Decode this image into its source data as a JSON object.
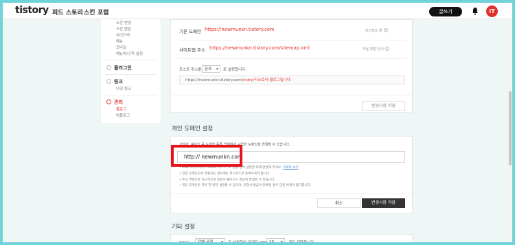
{
  "header": {
    "logo": "tistory",
    "nav": [
      "피드",
      "스토리",
      "스킨",
      "포럼"
    ],
    "write_button": "글쓰기",
    "avatar_text": "IT"
  },
  "sidebar": {
    "sub_items_top": [
      "스킨 변경",
      "스킨 편집",
      "사이드바",
      "메뉴",
      "모바일",
      "메뉴바/구독 설정"
    ],
    "plugin": "플러그인",
    "link": {
      "title": "링크",
      "sub": "나의 링크"
    },
    "manage": {
      "title": "관리",
      "subs": [
        "블로그",
        "팀블로그"
      ]
    }
  },
  "blog_settings": {
    "default_domain_label": "기본 도메인",
    "default_domain_value": "https://newmunkn.tistory.com",
    "default_domain_help": "보안접속 중",
    "sitemap_label": "사이트맵 주소",
    "sitemap_value": "https://newmunkn.tistory.com/sitemap.xml",
    "sitemap_help": "적용 방법 안내",
    "post_url_label": "포스트 주소를",
    "post_url_select": "문자",
    "post_url_suffix": "로 설정합니다.",
    "post_url_example_prefix": "https://newmunkn.tistory.com/",
    "post_url_example_red": "entry/티스토리-블로그입니다.",
    "save_button": "변경사항 저장"
  },
  "custom_domain": {
    "title": "개인 도메인 설정",
    "description": "가비아, 후이즈 등 도메인 등록 업체에서 구입한 도메인을 연결할 수 있습니다.",
    "input_value": "http://  newmunkn.com",
    "notes": [
      "DNS 서비스에서 CNAME 레코드, IP 등을 먼저 설정한 후에 연결해 주세요.",
      "한글 도메인으로 연결하는 경우에는 퓨니코드로 등록하셔야 합니다.",
      "주소 변경으로 일시적으로 방문이 줄어드는 현상이 발생할 수 있습니다.",
      "개인 도메인은 하루 한 번만 설정할 수 있으며, 인증서 발급이 완료된 경우 당일 변경이 불가합니다."
    ],
    "notes_link": "자세히 보기",
    "cancel_button": "취소",
    "save_button": "변경사항 저장"
  },
  "other_settings": {
    "title": "기타 설정",
    "rss_label": "RSS는",
    "rss_select": "전체 공개",
    "rss_mid": "로 설정하며 공개된 RSS를",
    "rss_count": "10",
    "rss_suffix": "개로 제한합니다."
  },
  "colors": {
    "accent": "#e0302a",
    "highlight_box": "#e8131a",
    "frame": "#6fd3d9"
  }
}
